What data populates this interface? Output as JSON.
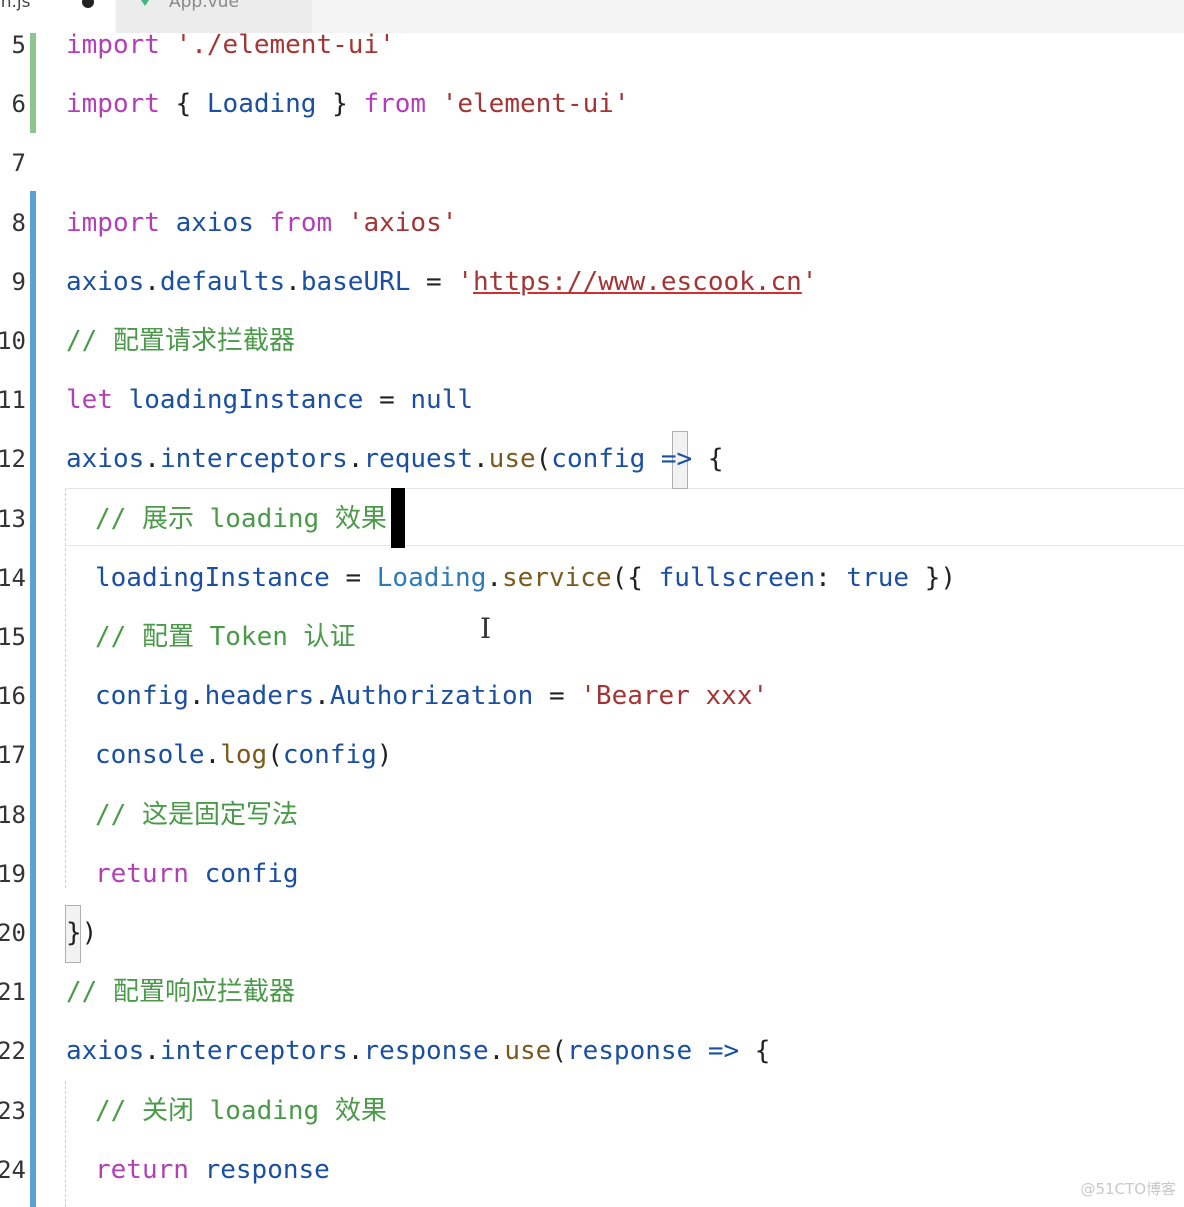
{
  "tabs": [
    {
      "label": "in.js",
      "modified": true
    },
    {
      "label": "App.vue",
      "icon": "vue-icon"
    }
  ],
  "lines": [
    {
      "n": "5",
      "indent": 0,
      "tokens": [
        [
          "kw",
          "import"
        ],
        [
          "pl",
          " "
        ],
        [
          "str",
          "'./element-ui'"
        ]
      ]
    },
    {
      "n": "6",
      "indent": 0,
      "tokens": [
        [
          "kw",
          "import"
        ],
        [
          "pl",
          " { "
        ],
        [
          "var",
          "Loading"
        ],
        [
          "pl",
          " } "
        ],
        [
          "kw",
          "from"
        ],
        [
          "pl",
          " "
        ],
        [
          "str",
          "'element-ui'"
        ]
      ]
    },
    {
      "n": "7",
      "indent": 0,
      "tokens": []
    },
    {
      "n": "8",
      "indent": 0,
      "tokens": [
        [
          "kw",
          "import"
        ],
        [
          "pl",
          " "
        ],
        [
          "var",
          "axios"
        ],
        [
          "pl",
          " "
        ],
        [
          "kw",
          "from"
        ],
        [
          "pl",
          " "
        ],
        [
          "str",
          "'axios'"
        ]
      ]
    },
    {
      "n": "9",
      "indent": 0,
      "tokens": [
        [
          "var",
          "axios"
        ],
        [
          "pl",
          "."
        ],
        [
          "var",
          "defaults"
        ],
        [
          "pl",
          "."
        ],
        [
          "var",
          "baseURL"
        ],
        [
          "pl",
          " = "
        ],
        [
          "str",
          "'"
        ],
        [
          "url",
          "https://www.escook.cn"
        ],
        [
          "str",
          "'"
        ]
      ]
    },
    {
      "n": "10",
      "indent": 0,
      "tokens": [
        [
          "cmt",
          "// 配置请求拦截器"
        ]
      ]
    },
    {
      "n": "11",
      "indent": 0,
      "tokens": [
        [
          "kw",
          "let"
        ],
        [
          "pl",
          " "
        ],
        [
          "var",
          "loadingInstance"
        ],
        [
          "pl",
          " = "
        ],
        [
          "var",
          "null"
        ]
      ]
    },
    {
      "n": "12",
      "indent": 0,
      "tokens": [
        [
          "var",
          "axios"
        ],
        [
          "pl",
          "."
        ],
        [
          "var",
          "interceptors"
        ],
        [
          "pl",
          "."
        ],
        [
          "var",
          "request"
        ],
        [
          "pl",
          "."
        ],
        [
          "fn",
          "use"
        ],
        [
          "pl",
          "("
        ],
        [
          "var",
          "config"
        ],
        [
          "pl",
          " "
        ],
        [
          "var",
          "=>"
        ],
        [
          "pl",
          " {"
        ]
      ]
    },
    {
      "n": "13",
      "indent": 1,
      "tokens": [
        [
          "cmt",
          "// 展示 loading 效果"
        ]
      ]
    },
    {
      "n": "14",
      "indent": 1,
      "tokens": [
        [
          "var",
          "loadingInstance"
        ],
        [
          "pl",
          " = "
        ],
        [
          "cls",
          "Loading"
        ],
        [
          "pl",
          "."
        ],
        [
          "fn",
          "service"
        ],
        [
          "pl",
          "({ "
        ],
        [
          "var",
          "fullscreen"
        ],
        [
          "pl",
          ": "
        ],
        [
          "var",
          "true"
        ],
        [
          "pl",
          " })"
        ]
      ]
    },
    {
      "n": "15",
      "indent": 1,
      "tokens": [
        [
          "cmt",
          "// 配置 Token 认证"
        ]
      ]
    },
    {
      "n": "16",
      "indent": 1,
      "tokens": [
        [
          "var",
          "config"
        ],
        [
          "pl",
          "."
        ],
        [
          "var",
          "headers"
        ],
        [
          "pl",
          "."
        ],
        [
          "var",
          "Authorization"
        ],
        [
          "pl",
          " = "
        ],
        [
          "str",
          "'Bearer xxx'"
        ]
      ]
    },
    {
      "n": "17",
      "indent": 1,
      "tokens": [
        [
          "var",
          "console"
        ],
        [
          "pl",
          "."
        ],
        [
          "fn",
          "log"
        ],
        [
          "pl",
          "("
        ],
        [
          "var",
          "config"
        ],
        [
          "pl",
          ")"
        ]
      ]
    },
    {
      "n": "18",
      "indent": 1,
      "tokens": [
        [
          "cmt",
          "// 这是固定写法"
        ]
      ]
    },
    {
      "n": "19",
      "indent": 1,
      "tokens": [
        [
          "kw",
          "return"
        ],
        [
          "pl",
          " "
        ],
        [
          "var",
          "config"
        ]
      ]
    },
    {
      "n": "20",
      "indent": 0,
      "tokens": [
        [
          "pl",
          "})"
        ]
      ]
    },
    {
      "n": "21",
      "indent": 0,
      "tokens": [
        [
          "cmt",
          "// 配置响应拦截器"
        ]
      ]
    },
    {
      "n": "22",
      "indent": 0,
      "tokens": [
        [
          "var",
          "axios"
        ],
        [
          "pl",
          "."
        ],
        [
          "var",
          "interceptors"
        ],
        [
          "pl",
          "."
        ],
        [
          "var",
          "response"
        ],
        [
          "pl",
          "."
        ],
        [
          "fn",
          "use"
        ],
        [
          "pl",
          "("
        ],
        [
          "var",
          "response"
        ],
        [
          "pl",
          " "
        ],
        [
          "var",
          "=>"
        ],
        [
          "pl",
          " {"
        ]
      ]
    },
    {
      "n": "23",
      "indent": 1,
      "tokens": [
        [
          "cmt",
          "// 关闭 loading 效果"
        ]
      ]
    },
    {
      "n": "24",
      "indent": 1,
      "tokens": [
        [
          "kw",
          "return"
        ],
        [
          "pl",
          " "
        ],
        [
          "var",
          "response"
        ]
      ]
    }
  ],
  "watermark": "@51CTO博客"
}
